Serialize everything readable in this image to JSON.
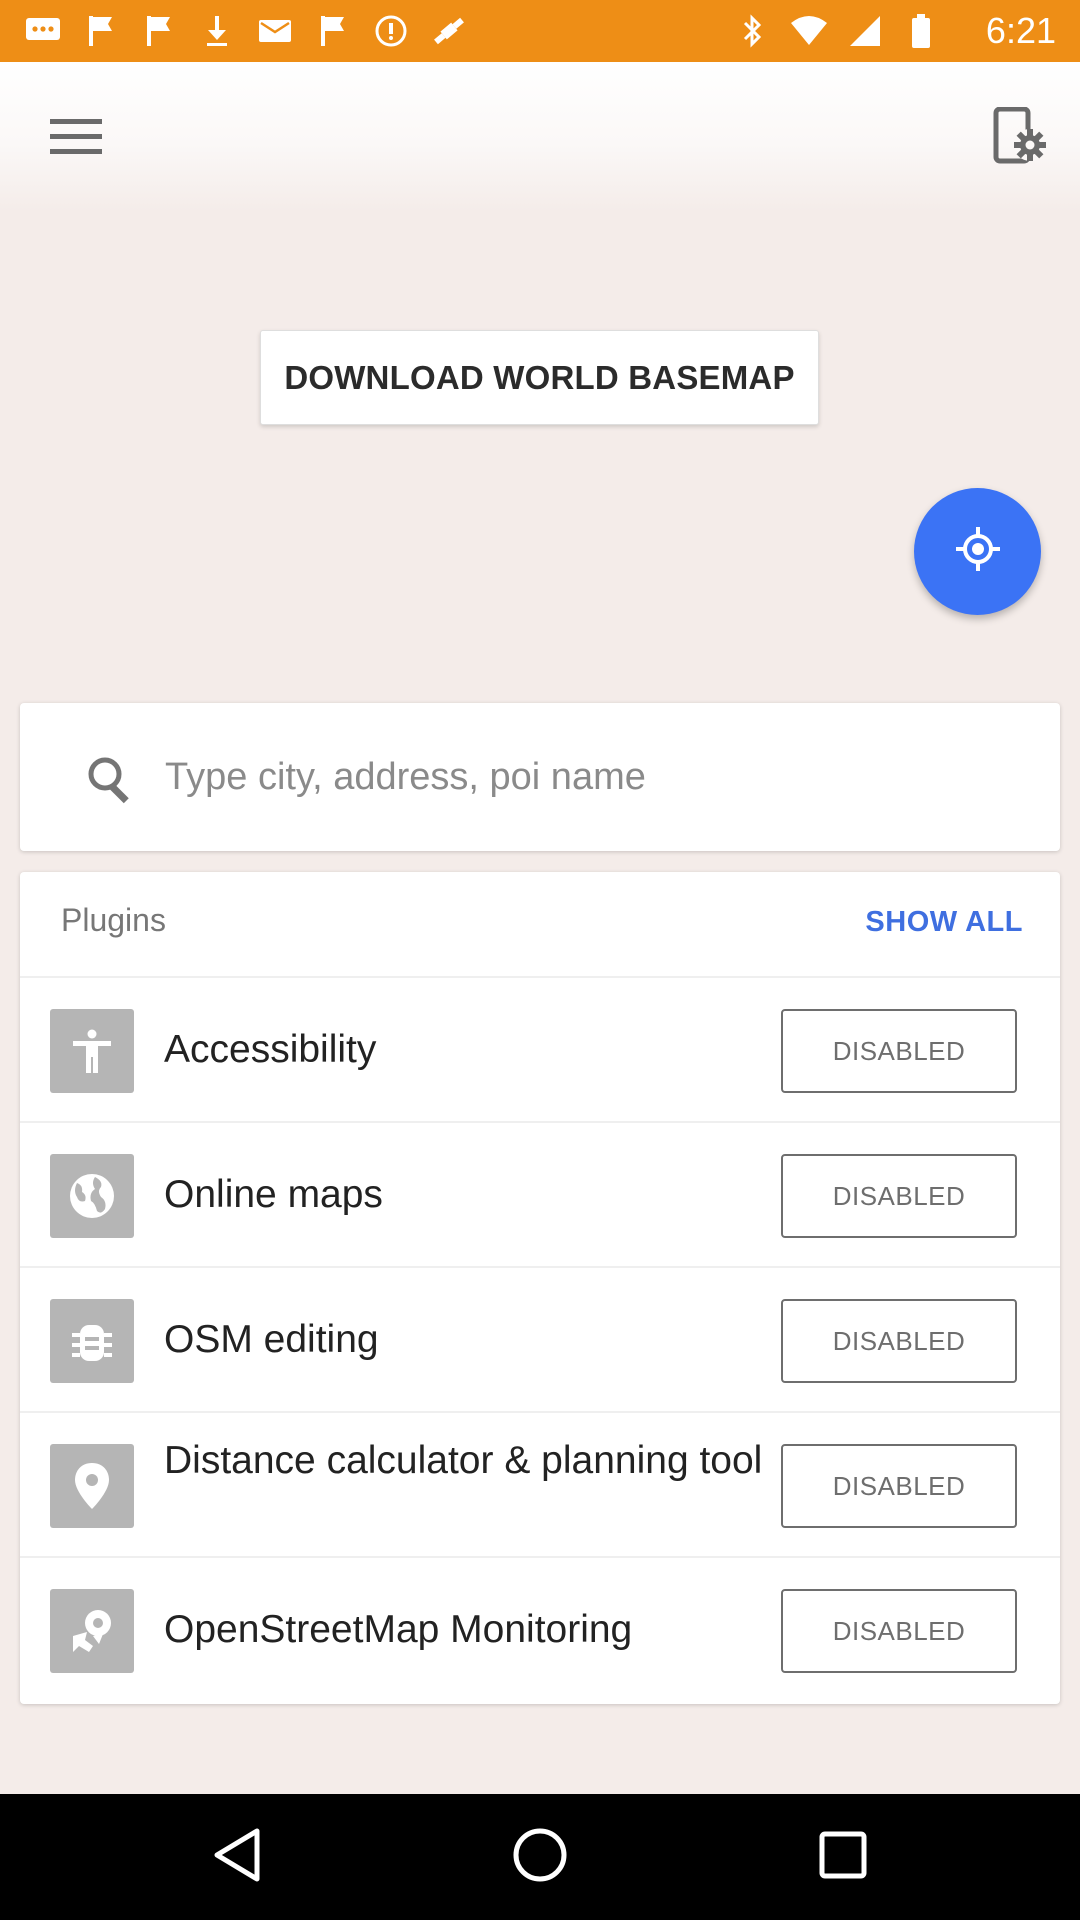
{
  "status_bar": {
    "time": "6:21",
    "left_icons": [
      "message-icon",
      "flag-icon",
      "flag-icon",
      "download-icon",
      "mail-icon",
      "flag-icon",
      "circle-icon",
      "fake-gps-icon"
    ],
    "right_icons": [
      "bluetooth-icon",
      "wifi-icon",
      "signal-icon",
      "battery-icon"
    ],
    "color": "#ee8e16"
  },
  "header": {
    "menu_icon": "menu-icon",
    "settings_icon": "device-settings-icon"
  },
  "map": {
    "download_button_label": "DOWNLOAD WORLD BASEMAP",
    "location_icon": "my-location-icon",
    "fab_color": "#3b73f5"
  },
  "search": {
    "placeholder": "Type city, address, poi name",
    "value": ""
  },
  "plugins": {
    "title": "Plugins",
    "show_all_label": "SHOW ALL",
    "accent": "#3f6fe0",
    "items": [
      {
        "name": "Accessibility",
        "status": "DISABLED",
        "icon": "accessibility-icon"
      },
      {
        "name": "Online maps",
        "status": "DISABLED",
        "icon": "globe-icon"
      },
      {
        "name": "OSM editing",
        "status": "DISABLED",
        "icon": "bug-icon"
      },
      {
        "name": "Distance calculator & planning tool",
        "status": "DISABLED",
        "icon": "location-pin-icon"
      },
      {
        "name": "OpenStreetMap Monitoring",
        "status": "DISABLED",
        "icon": "monitoring-icon"
      }
    ]
  },
  "nav_bar": {
    "buttons": [
      "back-icon",
      "home-icon",
      "recents-icon"
    ]
  }
}
